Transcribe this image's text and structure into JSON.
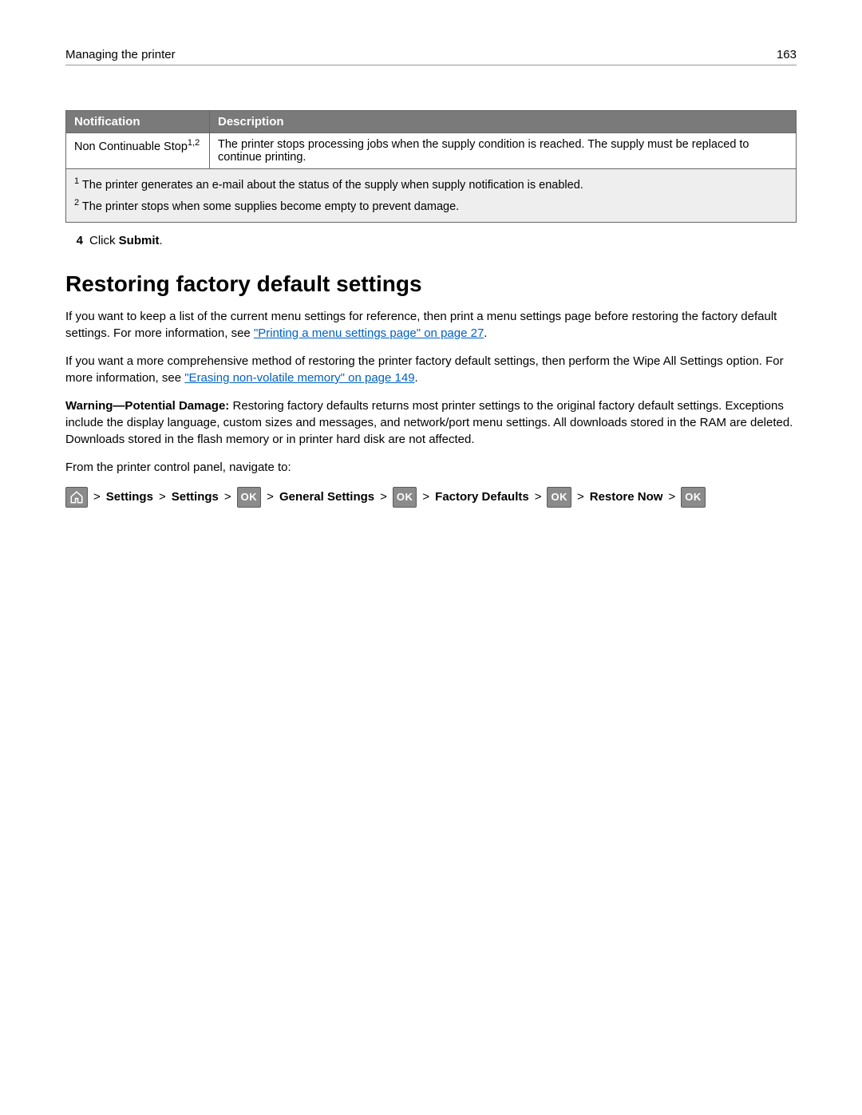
{
  "header": {
    "title": "Managing the printer",
    "page_number": "163"
  },
  "table": {
    "col1_header": "Notification",
    "col2_header": "Description",
    "row_notification": "Non Continuable Stop",
    "row_notification_sup": "1,2",
    "row_description": "The printer stops processing jobs when the supply condition is reached. The supply must be replaced to continue printing.",
    "footnote1_sup": "1",
    "footnote1_text": " The printer generates an e-mail about the status of the supply when supply notification is enabled.",
    "footnote2_sup": "2",
    "footnote2_text": " The printer stops when some supplies become empty to prevent damage."
  },
  "step": {
    "number": "4",
    "prefix": "Click ",
    "bold": "Submit",
    "suffix": "."
  },
  "heading": "Restoring factory default settings",
  "para1": {
    "text_a": "If you want to keep a list of the current menu settings for reference, then print a menu settings page before restoring the factory default settings. For more information, see ",
    "link": "\"Printing a menu settings page\" on page 27",
    "text_b": "."
  },
  "para2": {
    "text_a": "If you want a more comprehensive method of restoring the printer factory default settings, then perform the Wipe All Settings option. For more information, see ",
    "link": "\"Erasing non-volatile memory\" on page 149",
    "text_b": "."
  },
  "para3": {
    "bold_a": "Warning—Potential Damage:",
    "text": " Restoring factory defaults returns most printer settings to the original factory default settings. Exceptions include the display language, custom sizes and messages, and network/port menu settings. All downloads stored in the RAM are deleted. Downloads stored in the flash memory or in printer hard disk are not affected."
  },
  "para4": "From the printer control panel, navigate to:",
  "nav": {
    "sep": ">",
    "s1": "Settings",
    "s2": "Settings",
    "s3": "General Settings",
    "s4": "Factory Defaults",
    "s5": "Restore Now",
    "ok_label": "OK"
  }
}
